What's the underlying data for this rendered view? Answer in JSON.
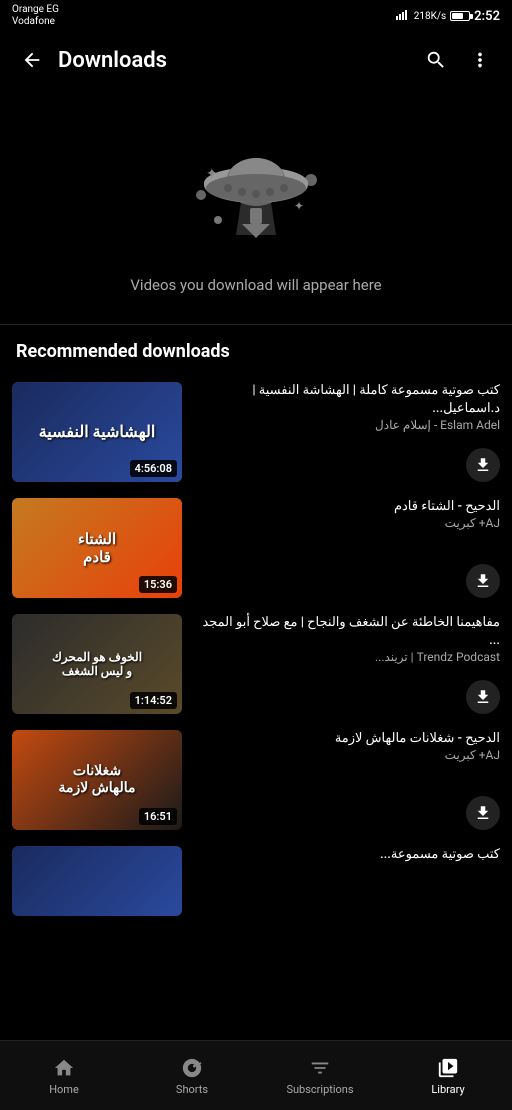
{
  "status": {
    "carrier": "Orange EG",
    "carrier2": "Vodafone",
    "speed": "218K/s",
    "battery": "42",
    "time": "2:52"
  },
  "header": {
    "back_label": "back",
    "title": "Downloads",
    "search_label": "search",
    "more_label": "more options"
  },
  "empty_state": {
    "message": "Videos you download will appear here"
  },
  "recommended": {
    "section_title": "Recommended downloads",
    "items": [
      {
        "id": 1,
        "title": "كتب صوتية مسموعة كاملة | الهشاشة النفسية  | د.اسماعيل...",
        "channel": "Eslam Adel - إسلام عادل",
        "duration": "4:56:08",
        "thumb_type": "1",
        "thumb_label": "الهشاشية النفسية"
      },
      {
        "id": 2,
        "title": "الدحيح - الشتاء قادم",
        "channel": "AJ+ كبريت",
        "duration": "15:36",
        "thumb_type": "2",
        "thumb_label": "الشتاء قادم",
        "badge": "AJ+"
      },
      {
        "id": 3,
        "title": "مفاهيمنا الخاطئة عن الشغف والنجاح | مع صلاح أبو المجد ...",
        "channel": "Trendz Podcast | تريند...",
        "duration": "1:14:52",
        "thumb_type": "3",
        "thumb_label": "الخوف هو المحرك و ليس الشغف",
        "badge": ""
      },
      {
        "id": 4,
        "title": "الدحيح - شغلانات مالهاش لازمة",
        "channel": "AJ+ كبريت",
        "duration": "16:51",
        "thumb_type": "4",
        "thumb_label": "شغلانات مالهاش لازمة",
        "badge": "AJ+"
      },
      {
        "id": 5,
        "title": "كتب صوتية مسموعة...",
        "channel": "",
        "duration": "",
        "thumb_type": "5",
        "thumb_label": "",
        "badge": ""
      }
    ]
  },
  "bottom_nav": {
    "items": [
      {
        "id": "home",
        "label": "Home",
        "active": false
      },
      {
        "id": "shorts",
        "label": "Shorts",
        "active": false
      },
      {
        "id": "subscriptions",
        "label": "Subscriptions",
        "active": false
      },
      {
        "id": "library",
        "label": "Library",
        "active": true
      }
    ]
  }
}
